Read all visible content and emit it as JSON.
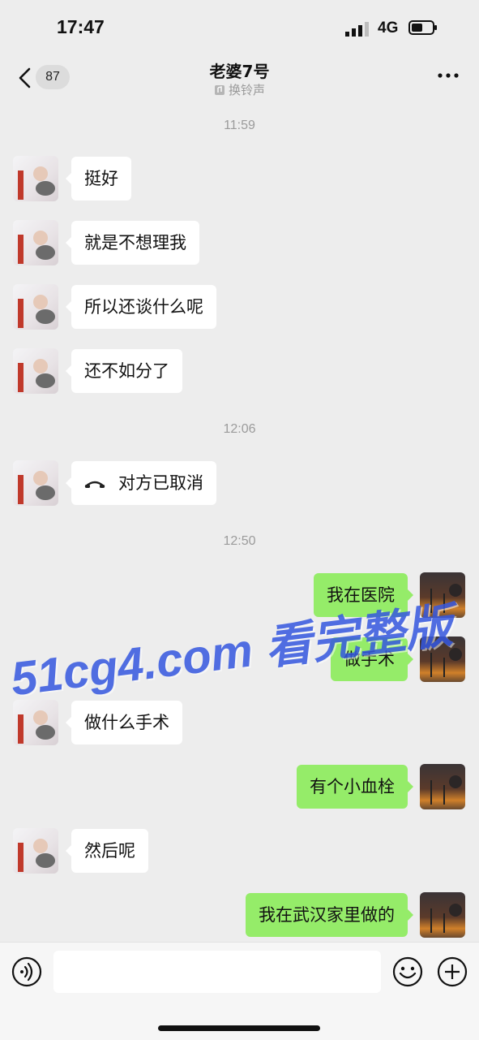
{
  "status_bar": {
    "time": "17:47",
    "network": "4G"
  },
  "header": {
    "unread_count": "87",
    "title": "老婆7号",
    "subtitle": "换铃声"
  },
  "messages": {
    "ts1": "11:59",
    "m1": "挺好",
    "m2": "就是不想理我",
    "m3": "所以还谈什么呢",
    "m4": "还不如分了",
    "ts2": "12:06",
    "call": "对方已取消",
    "ts3": "12:50",
    "m5": "我在医院",
    "m6": "做手术",
    "m7": "做什么手术",
    "m8": "有个小血栓",
    "m9": "然后呢",
    "m10": "我在武汉家里做的"
  },
  "watermark": "51cg4.com 看完整版",
  "icons": [
    "back-chevron-icon",
    "more-icon",
    "ringtone-icon",
    "call-icon",
    "voice-icon",
    "emoji-icon",
    "plus-icon"
  ],
  "colors": {
    "background": "#ededed",
    "bubble_out": "#95ec69",
    "bubble_in": "#ffffff",
    "watermark": "#3557e0"
  }
}
